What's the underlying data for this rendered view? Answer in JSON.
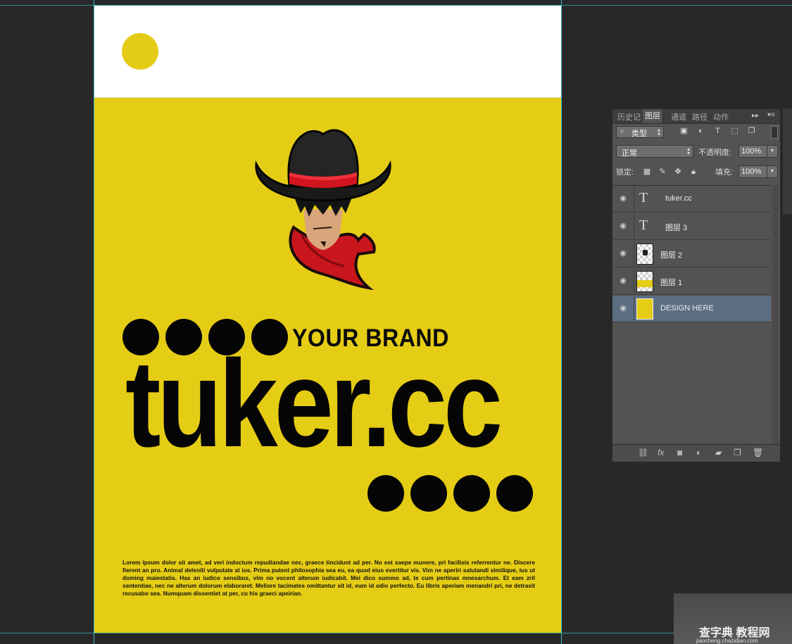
{
  "canvas": {
    "brand_text": "YOUR BRAND",
    "headline": "tuker.cc",
    "body_text": "Lorem ipsum dolor sit amet, ad veri indoctum repudiandae nec, graece tincidunt ad per. No est saepe munere, pri facilisis referrentur ne. Discere fierent an pro. Animal deleniti vulputate at ius. Prima putent philosophia sea eu, ea quod eius evertitur vis. Vim ne aperiri salutandi similique, ius ut doming maiestatis. Has an iudico sensibus, vim no vocent alterum iudicabit. Mei dico summo ad, te cum pertinax mnesarchum. Et eam zril sententiae, nec ne alterum dolorum elaboraret. Meliore tacimates omittantur sit id, eum id odio perfecto. Eu libris aperiam menandri pri, ne detraxit recusabo sea. Numquam dissentiet at per, cu his graeci apeirian.",
    "colors": {
      "yellow": "#e6cd15",
      "black": "#050505",
      "white": "#ffffff",
      "guide": "#3fd3e3"
    }
  },
  "layers_panel": {
    "tabs": [
      "历史记",
      "图层",
      "通道",
      "路径",
      "动作"
    ],
    "active_tab": "图层",
    "filter_label": "类型",
    "blend_mode": "正常",
    "opacity_label": "不透明度:",
    "opacity_value": "100%",
    "lock_label": "锁定:",
    "fill_label": "填充:",
    "fill_value": "100%",
    "layers": [
      {
        "name": "tuker.cc",
        "kind": "text",
        "visible": true,
        "selected": false
      },
      {
        "name": "图层 3",
        "kind": "text",
        "visible": true,
        "selected": false
      },
      {
        "name": "图层 2",
        "kind": "image",
        "visible": true,
        "selected": false
      },
      {
        "name": "图层 1",
        "kind": "image",
        "visible": true,
        "selected": false
      },
      {
        "name": "DESIGN HERE",
        "kind": "image",
        "visible": true,
        "selected": true
      }
    ],
    "footer_icons": [
      "link-icon",
      "fx-icon",
      "mask-icon",
      "adjustment-icon",
      "folder-icon",
      "new-layer-icon",
      "trash-icon"
    ]
  },
  "watermark": {
    "title": "查字典 教程网",
    "url": "jiaocheng.chazidian.com"
  }
}
